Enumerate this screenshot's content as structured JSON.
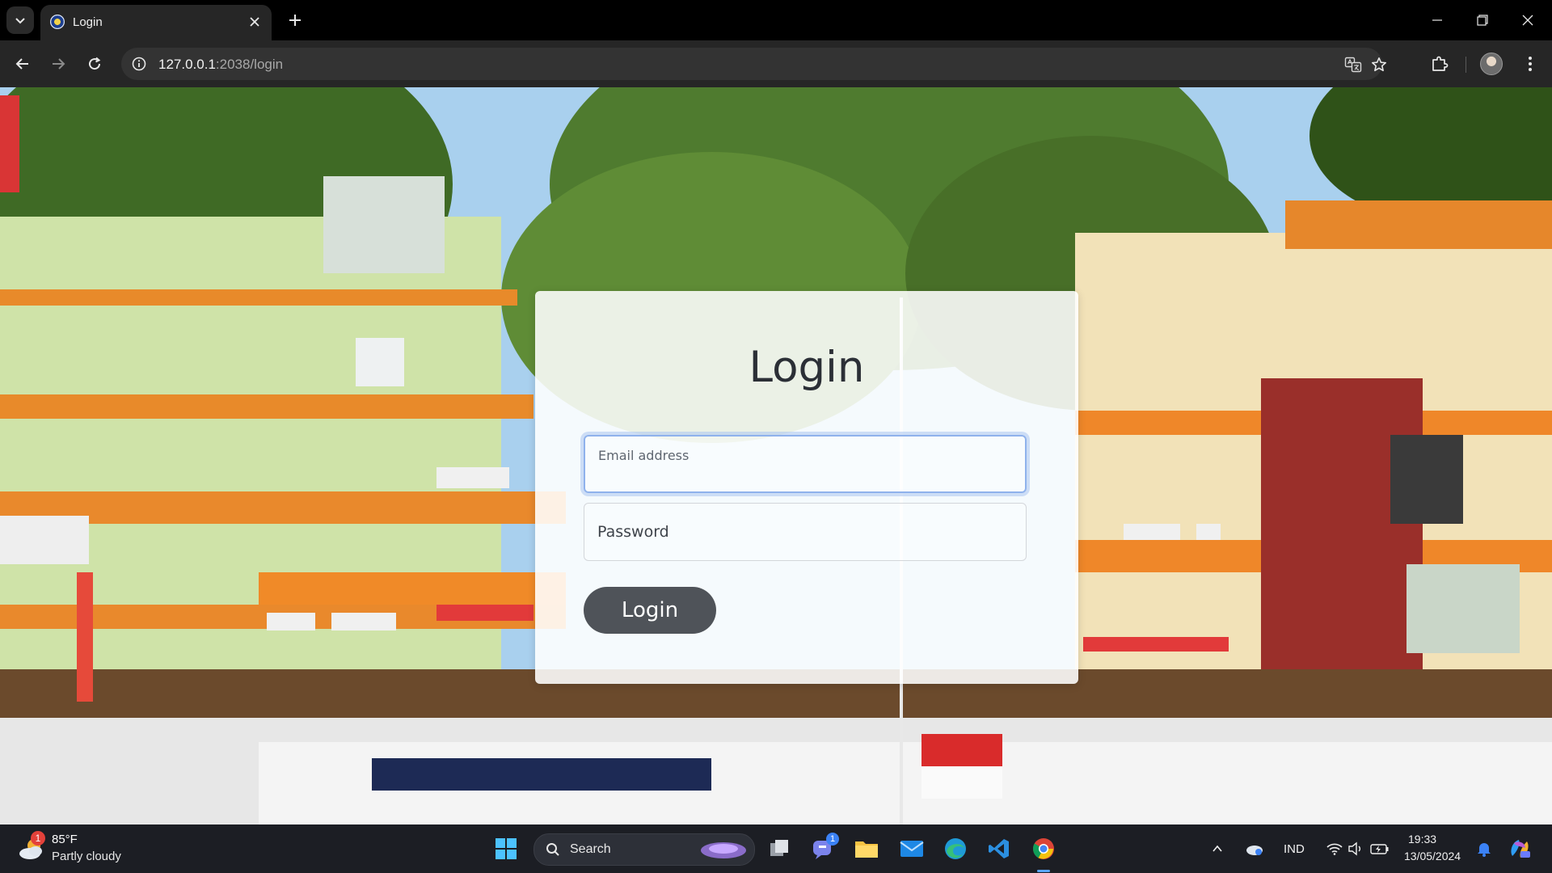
{
  "browser": {
    "tab": {
      "title": "Login"
    },
    "url": {
      "host": "127.0.0.1",
      "rest": ":2038/login"
    }
  },
  "form": {
    "title": "Login",
    "email": {
      "placeholder": "Email address",
      "value": ""
    },
    "password": {
      "placeholder": "Password",
      "value": ""
    },
    "submit_label": "Login"
  },
  "taskbar": {
    "weather": {
      "temp": "85°F",
      "desc": "Partly cloudy",
      "badge": "1"
    },
    "search_label": "Search",
    "teams_badge": "1",
    "language": "IND",
    "time": "19:33",
    "date": "13/05/2024"
  },
  "icons": {
    "tab_search": "chevron-down-icon",
    "close": "close-icon",
    "new_tab": "plus-icon",
    "back": "arrow-left-icon",
    "forward": "arrow-right-icon",
    "reload": "reload-icon",
    "site_info": "info-icon",
    "translate": "translate-icon",
    "bookmark": "star-icon",
    "extensions": "puzzle-icon",
    "menu": "kebab-menu-icon"
  },
  "colors": {
    "chrome_dark": "#000000",
    "toolbar": "#262626",
    "card_bg": "#ffffffe0",
    "button_bg": "#4f5359",
    "focus_ring": "#8fb2ec",
    "taskbar": "#1c1e24"
  }
}
